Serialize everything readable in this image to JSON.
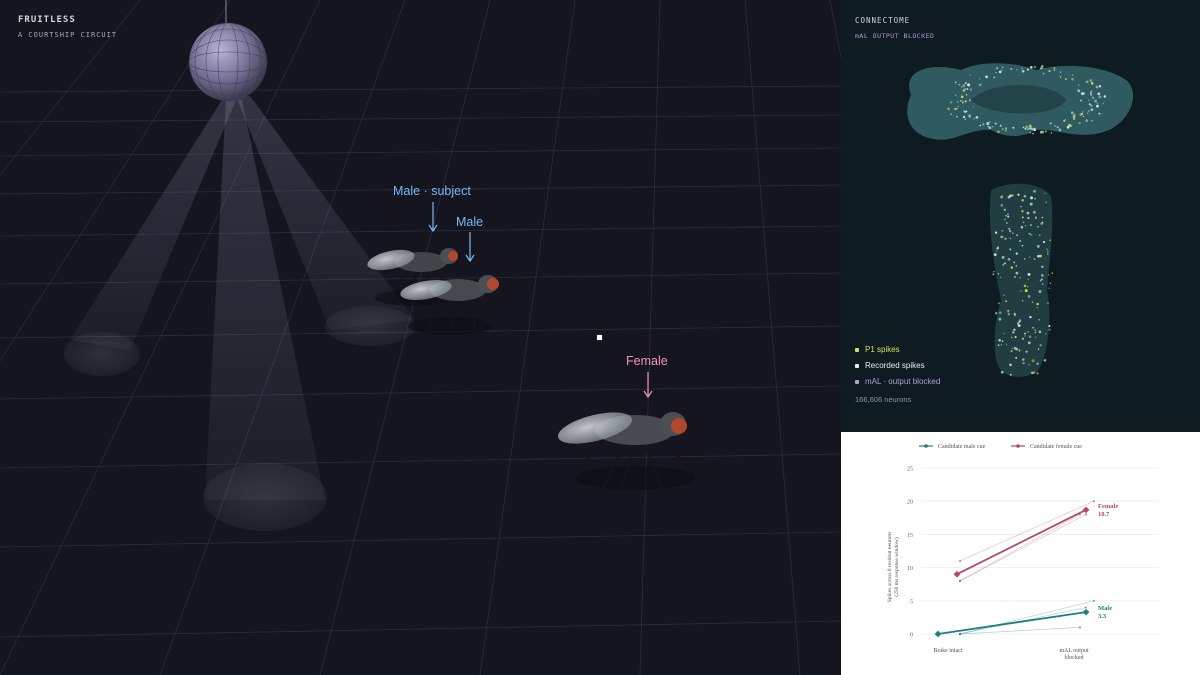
{
  "app": {
    "title": "FRUITLESS",
    "subtitle": "A COURTSHIP CIRCUIT"
  },
  "scene": {
    "labels": {
      "subject": "Male · subject",
      "male": "Male",
      "female": "Female"
    },
    "colors": {
      "male_label": "#79b8f7",
      "female_label": "#ef95b0"
    },
    "icons": [
      "disco-ball-icon",
      "fly-icon"
    ]
  },
  "connectome": {
    "title": "CONNECTOME",
    "state": "mAL OUTPUT BLOCKED",
    "legend": [
      {
        "label": "P1 spikes",
        "color": "#d4e157"
      },
      {
        "label": "Recorded spikes",
        "color": "#e6eef0"
      },
      {
        "label": "mAL · output blocked",
        "color": "#b39ddb"
      }
    ],
    "neuron_count": "166,606 neurons"
  },
  "chart_data": {
    "type": "line",
    "x": [
      "Brake intact",
      "mAL output blocked"
    ],
    "ylabel": "Spikes across 8 readout neurons (250 ms response window)",
    "ylim": [
      0,
      25
    ],
    "yticks": [
      0,
      5,
      10,
      15,
      20,
      25
    ],
    "grid": true,
    "legend_position": "top",
    "series": [
      {
        "name": "Candidate male cue",
        "color": "#1f7f7c",
        "values": [
          0,
          3.3
        ],
        "end_label": "Male",
        "end_value_label": "3.3",
        "replicates": [
          [
            0,
            5
          ],
          [
            0,
            4
          ],
          [
            0,
            1
          ]
        ]
      },
      {
        "name": "Candidate female cue",
        "color": "#b34a66",
        "values": [
          9,
          18.7
        ],
        "end_label": "Female",
        "end_value_label": "18.7",
        "replicates": [
          [
            11,
            20
          ],
          [
            8,
            18
          ],
          [
            8,
            18
          ]
        ]
      }
    ]
  }
}
